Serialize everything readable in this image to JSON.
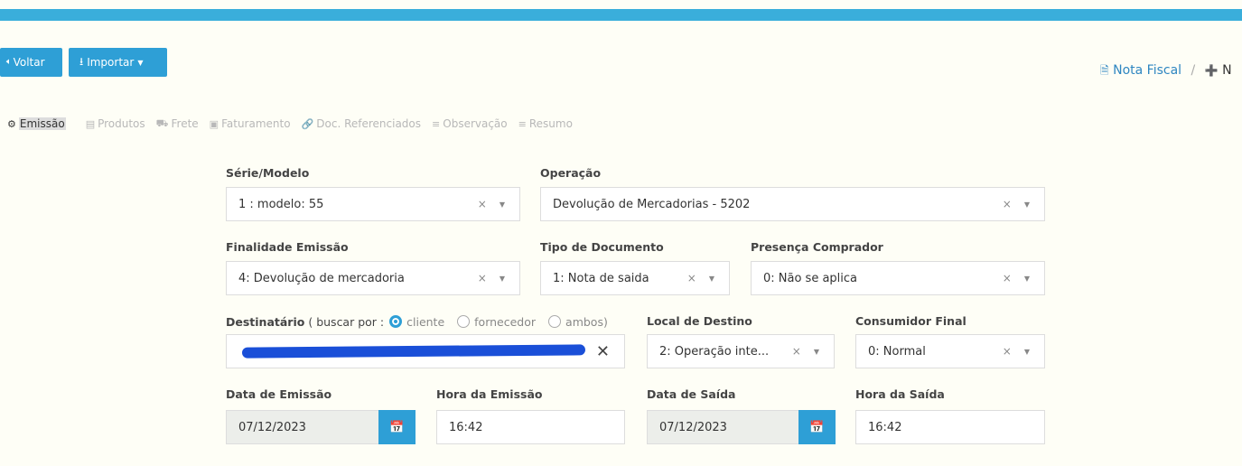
{
  "toolbar": {
    "back_label": "Voltar",
    "back_icon": "arrow-left-icon",
    "import_label": "Importar",
    "import_icon": "download-icon"
  },
  "breadcrumb": {
    "item1": "Nota Fiscal",
    "separator": "/",
    "item2": "N"
  },
  "tabs": [
    {
      "label": "Emissão",
      "icon": "gear-icon",
      "active": true
    },
    {
      "label": "Produtos",
      "icon": "barcode-icon"
    },
    {
      "label": "Frete",
      "icon": "truck-icon"
    },
    {
      "label": "Faturamento",
      "icon": "money-icon"
    },
    {
      "label": "Doc. Referenciados",
      "icon": "link-icon"
    },
    {
      "label": "Observação",
      "icon": "list-icon"
    },
    {
      "label": "Resumo",
      "icon": "list-icon"
    }
  ],
  "form": {
    "serie_label": "Série/Modelo",
    "serie_value": "1 : modelo: 55",
    "operacao_label": "Operação",
    "operacao_value": "Devolução de Mercadorias - 5202",
    "finalidade_label": "Finalidade Emissão",
    "finalidade_value": "4: Devolução de mercadoria",
    "tipo_label": "Tipo de Documento",
    "tipo_value": "1: Nota de saida",
    "presenca_label": "Presença Comprador",
    "presenca_value": "0: Não se aplica",
    "destinatario_label": "Destinatário",
    "buscar_label": "( buscar por :",
    "radio_cliente": "cliente",
    "radio_fornecedor": "fornecedor",
    "radio_ambos": "ambos)",
    "local_label": "Local de Destino",
    "local_value": "2: Operação inte...",
    "consumidor_label": "Consumidor Final",
    "consumidor_value": "0: Normal",
    "data_emissao_label": "Data de Emissão",
    "data_emissao_value": "07/12/2023",
    "hora_emissao_label": "Hora da Emissão",
    "hora_emissao_value": "16:42",
    "data_saida_label": "Data de Saída",
    "data_saida_value": "07/12/2023",
    "hora_saida_label": "Hora da Saída",
    "hora_saida_value": "16:42",
    "clear_glyph": "×",
    "caret_glyph": "▼"
  },
  "colors": {
    "accent": "#2e9fd6",
    "topbar": "#3aaedb",
    "background": "#fefef6"
  }
}
